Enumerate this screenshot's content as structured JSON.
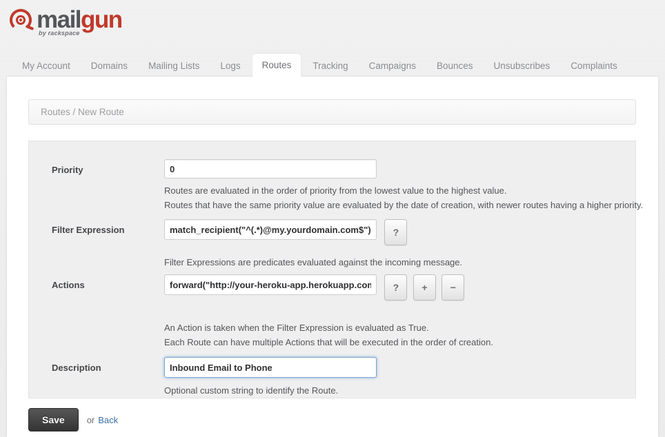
{
  "brand": {
    "name_part1": "mail",
    "name_part2": "gun",
    "subtitle": "by rackspace"
  },
  "nav": {
    "tabs": [
      {
        "label": "My Account",
        "active": false
      },
      {
        "label": "Domains",
        "active": false
      },
      {
        "label": "Mailing Lists",
        "active": false
      },
      {
        "label": "Logs",
        "active": false
      },
      {
        "label": "Routes",
        "active": true
      },
      {
        "label": "Tracking",
        "active": false
      },
      {
        "label": "Campaigns",
        "active": false
      },
      {
        "label": "Bounces",
        "active": false
      },
      {
        "label": "Unsubscribes",
        "active": false
      },
      {
        "label": "Complaints",
        "active": false
      }
    ]
  },
  "breadcrumb": {
    "text": "Routes / New Route"
  },
  "form": {
    "priority": {
      "label": "Priority",
      "value": "0",
      "help_line1": "Routes are evaluated in the order of priority from the lowest value to the highest value.",
      "help_line2": "Routes that have the same priority value are evaluated by the date of creation, with newer routes having a higher priority."
    },
    "filter_expression": {
      "label": "Filter Expression",
      "value": "match_recipient(\"^(.*)@my.yourdomain.com$\")",
      "help_button": "?",
      "help_line1": "Filter Expressions are predicates evaluated against the incoming message."
    },
    "actions": {
      "label": "Actions",
      "value": "forward(\"http://your-heroku-app.herokuapp.com/reverse\")",
      "help_button": "?",
      "add_button": "+",
      "remove_button": "−",
      "help_line1": "An Action is taken when the Filter Expression is evaluated as True.",
      "help_line2": "Each Route can have multiple Actions that will be executed in the order of creation."
    },
    "description": {
      "label": "Description",
      "value": "Inbound Email to Phone",
      "focused": true,
      "help_line1": "Optional custom string to identify the Route."
    }
  },
  "footer": {
    "save_label": "Save",
    "or_label": "or",
    "back_label": "Back"
  },
  "colors": {
    "brand_red": "#c0392b",
    "brand_gray": "#55565a",
    "link_blue": "#3a6ea5",
    "focus_blue": "#5291cc"
  }
}
